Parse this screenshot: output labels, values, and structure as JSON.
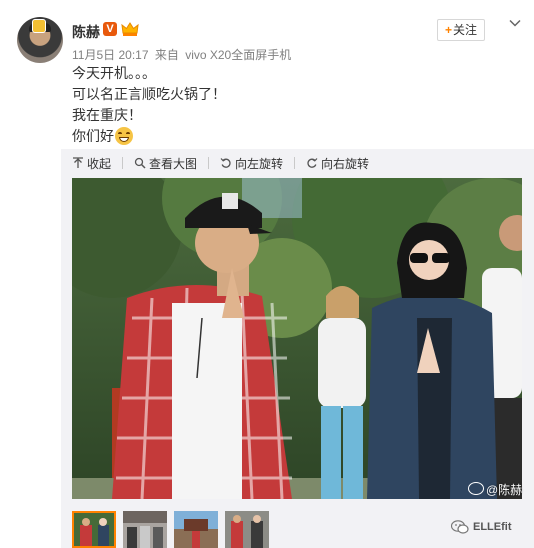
{
  "author": {
    "name": "陈赫",
    "verified_label": "V"
  },
  "meta": {
    "time": "11月5日 20:17",
    "source_prefix": "来自",
    "source": "vivo X20全面屏手机"
  },
  "follow_button": {
    "plus": "+",
    "label": "关注"
  },
  "content": {
    "lines": [
      "今天开机。。。",
      "可以名正言顺吃火锅了！",
      "我在重庆！",
      "你们好"
    ]
  },
  "toolbar": {
    "collapse": "收起",
    "view_large": "查看大图",
    "rotate_left": "向左旋转",
    "rotate_right": "向右旋转"
  },
  "photo": {
    "watermark": "@陈赫"
  },
  "brand": {
    "label": "ELLEfit"
  },
  "icons": [
    "avatar",
    "verified-badge",
    "crown-icon",
    "chevron-down-icon",
    "collapse-icon",
    "zoom-icon",
    "rotate-left-icon",
    "rotate-right-icon",
    "smile-emoji-icon",
    "wechat-icon"
  ],
  "colors": {
    "accent": "#ff8200",
    "text": "#333333",
    "muted": "#808080",
    "panel": "#f2f2f5"
  }
}
